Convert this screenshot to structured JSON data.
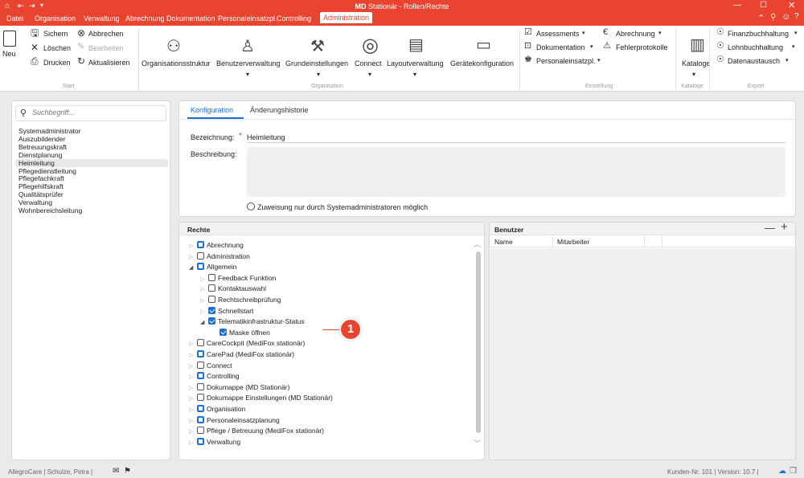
{
  "window": {
    "title": "MD Stationär - Rollen/Rechte",
    "title_prefix": "MD",
    "title_rest": "Stationär - Rollen/Rechte"
  },
  "menu": [
    "Datei",
    "Organisation",
    "Verwaltung",
    "Abrechnung",
    "Dokumentation",
    "Personaleinsatzpl.",
    "Controlling",
    "Administration"
  ],
  "ribbon": {
    "neu": "Neu",
    "sichern": "Sichern",
    "abbrechen": "Abbrechen",
    "loeschen": "Löschen",
    "bearbeiten": "Bearbeiten",
    "drucken": "Drucken",
    "aktualisieren": "Aktualisieren",
    "org": [
      "Organisationsstruktur",
      "Benutzerverwaltung",
      "Grundeinstellungen",
      "Connect",
      "Layoutverwaltung",
      "Gerätekonfiguration"
    ],
    "einst": {
      "assessments": "Assessments",
      "abrechnung": "Abrechnung",
      "dokumentation": "Dokumentation",
      "fehlerprotokolle": "Fehlerprotokolle",
      "personaleinsatzpl": "Personaleinsatzpl."
    },
    "kataloge": "Kataloge",
    "export": {
      "fibu": "Finanzbuchhaltung",
      "lohn": "Lohnbuchhaltung",
      "daten": "Datenaustausch"
    },
    "groups": {
      "start": "Start",
      "organisation": "Organisation",
      "einstellung": "Einstellung",
      "kataloge": "Kataloge",
      "export": "Export"
    }
  },
  "search": {
    "placeholder": "Suchbegriff..."
  },
  "roles": [
    "Systemadministrator",
    "Auszubildender",
    "Betreuungskraft",
    "Dienstplanung",
    "Heimleitung",
    "Pflegedienstleitung",
    "Pflegefachkraft",
    "Pflegehilfskraft",
    "Qualitätsprüfer",
    "Verwaltung",
    "Wohnbereichsleitung"
  ],
  "tabs": {
    "konfiguration": "Konfiguration",
    "historie": "Änderungshistorie"
  },
  "form": {
    "bezeichnung_label": "Bezeichnung:",
    "bezeichnung_value": "Heimleitung",
    "beschreibung_label": "Beschreibung:",
    "zuweisung_label": "Zuweisung nur durch Systemadministratoren möglich",
    "required_mark": "*"
  },
  "rechte": {
    "title": "Rechte",
    "items": [
      {
        "label": "Abrechnung",
        "level": 0,
        "state": "partial",
        "arrow": "closed"
      },
      {
        "label": "Administration",
        "level": 0,
        "state": "none",
        "arrow": "closed"
      },
      {
        "label": "Allgemein",
        "level": 0,
        "state": "partial",
        "arrow": "open"
      },
      {
        "label": "Feedback Funktion",
        "level": 1,
        "state": "none",
        "arrow": "closed"
      },
      {
        "label": "Kontaktauswahl",
        "level": 1,
        "state": "none",
        "arrow": "closed"
      },
      {
        "label": "Rechtschreibprüfung",
        "level": 1,
        "state": "none",
        "arrow": "closed"
      },
      {
        "label": "Schnellstart",
        "level": 1,
        "state": "checked",
        "arrow": "closed"
      },
      {
        "label": "Telematikinfrastruktur-Status",
        "level": 1,
        "state": "checked",
        "arrow": "open"
      },
      {
        "label": "Maske öffnen",
        "level": 2,
        "state": "checked",
        "arrow": "none"
      },
      {
        "label": "CareCockpit (MediFox stationär)",
        "level": 0,
        "state": "none",
        "arrow": "closed"
      },
      {
        "label": "CarePad (MediFox stationär)",
        "level": 0,
        "state": "partial",
        "arrow": "closed"
      },
      {
        "label": "Connect",
        "level": 0,
        "state": "none",
        "arrow": "closed"
      },
      {
        "label": "Controlling",
        "level": 0,
        "state": "partial",
        "arrow": "closed"
      },
      {
        "label": "Dokumappe (MD Stationär)",
        "level": 0,
        "state": "none",
        "arrow": "closed"
      },
      {
        "label": "Dokumappe Einstellungen (MD Stationär)",
        "level": 0,
        "state": "none",
        "arrow": "closed"
      },
      {
        "label": "Organisation",
        "level": 0,
        "state": "partial",
        "arrow": "closed"
      },
      {
        "label": "Personaleinsatzplanung",
        "level": 0,
        "state": "partial",
        "arrow": "closed"
      },
      {
        "label": "Pflege / Betreuung (MediFox stationär)",
        "level": 0,
        "state": "none",
        "arrow": "closed"
      },
      {
        "label": "Verwaltung",
        "level": 0,
        "state": "partial",
        "arrow": "closed"
      }
    ]
  },
  "benutzer": {
    "title": "Benutzer",
    "col_name": "Name",
    "col_mitarbeiter": "Mitarbeiter"
  },
  "callout": "1",
  "status": {
    "left": "AllegroCare | Schulze, Petra |",
    "right": "Kunden-Nr. 101 | Version: 10.7 |"
  },
  "colors": {
    "accent": "#e8442f",
    "check": "#1a73d9"
  }
}
